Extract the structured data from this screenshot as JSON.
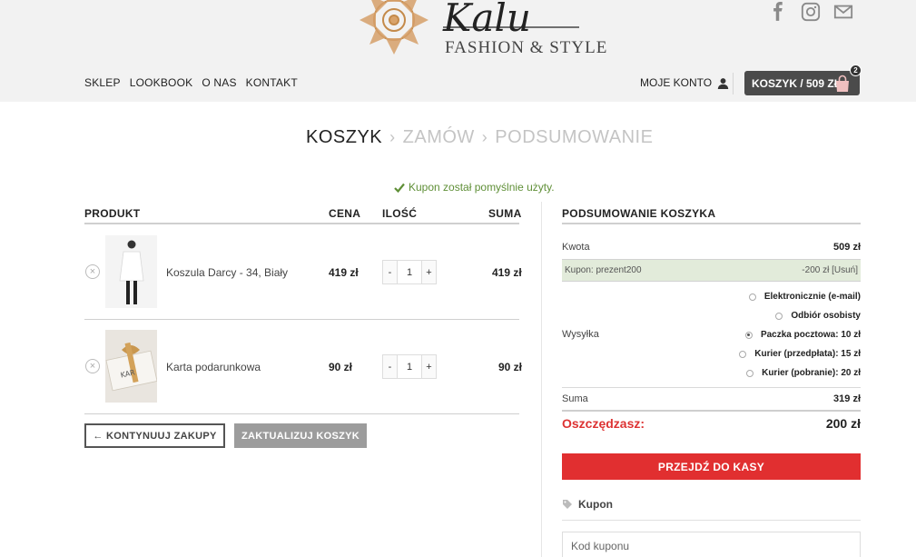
{
  "header": {
    "logo_script": "Kalu",
    "logo_subtitle": "FASHION & STYLE",
    "nav": [
      "SKLEP",
      "LOOKBOOK",
      "O NAS",
      "KONTAKT"
    ],
    "account_label": "MOJE KONTO",
    "cart_label": "KOSZYK / 509 ZŁ",
    "cart_count": "2",
    "social_icons": [
      "facebook-icon",
      "instagram-icon",
      "mail-icon"
    ]
  },
  "breadcrumb": {
    "steps": [
      "KOSZYK",
      "ZAMÓW",
      "PODSUMOWANIE"
    ],
    "separator": "›"
  },
  "notice": "Kupon został pomyślnie użyty.",
  "cart": {
    "headers": {
      "product": "PRODUKT",
      "price": "CENA",
      "qty": "ILOŚĆ",
      "total": "SUMA"
    },
    "items": [
      {
        "name": "Koszula Darcy - 34, Biały",
        "price": "419 zł",
        "qty": "1",
        "total": "419 zł"
      },
      {
        "name": "Karta podarunkowa",
        "price": "90 zł",
        "qty": "1",
        "total": "90 zł"
      }
    ],
    "qty_minus": "-",
    "qty_plus": "+",
    "continue_label": "← KONTYNUUJ ZAKUPY",
    "update_label": "ZAKTUALIZUJ KOSZYK"
  },
  "summary": {
    "title": "PODSUMOWANIE KOSZYKA",
    "amount_label": "Kwota",
    "amount_value": "509 zł",
    "coupon_label": "Kupon: prezent200",
    "coupon_value": "-200 zł",
    "coupon_remove": "[Usuń]",
    "shipping_label": "Wysyłka",
    "shipping_options": [
      {
        "label": "Elektronicznie (e-mail)",
        "selected": false
      },
      {
        "label": "Odbiór osobisty",
        "selected": false
      },
      {
        "label": "Paczka pocztowa: 10 zł",
        "selected": true
      },
      {
        "label": "Kurier (przedpłata): 15 zł",
        "selected": false
      },
      {
        "label": "Kurier (pobranie): 20 zł",
        "selected": false
      }
    ],
    "sum_label": "Suma",
    "sum_value": "319 zł",
    "save_label": "Oszczędzasz:",
    "save_value": "200 zł",
    "checkout_label": "PRZEJDŹ DO KASY",
    "coupon_section_title": "Kupon",
    "coupon_placeholder": "Kod kuponu"
  },
  "colors": {
    "accent_red": "#e12f30",
    "success_green": "#5f8f37",
    "coupon_row_bg": "#e2ebda"
  }
}
